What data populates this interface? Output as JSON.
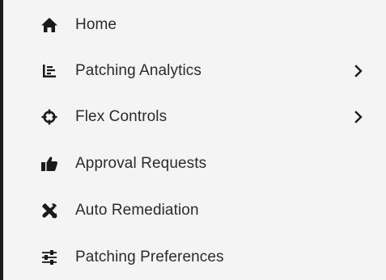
{
  "sidebar": {
    "items": [
      {
        "label": "Home",
        "icon": "home-icon",
        "has_submenu": false
      },
      {
        "label": "Patching Analytics",
        "icon": "analytics-chart-icon",
        "has_submenu": true
      },
      {
        "label": "Flex Controls",
        "icon": "crosshair-icon",
        "has_submenu": true
      },
      {
        "label": "Approval Requests",
        "icon": "thumbs-up-icon",
        "has_submenu": false
      },
      {
        "label": "Auto Remediation",
        "icon": "wrench-screwdriver-icon",
        "has_submenu": false
      },
      {
        "label": "Patching Preferences",
        "icon": "sliders-icon",
        "has_submenu": false
      }
    ]
  },
  "colors": {
    "background": "#f4f4f4",
    "text": "#2b2b2b",
    "icon": "#1a1a1a",
    "border": "#1c1c1c"
  }
}
